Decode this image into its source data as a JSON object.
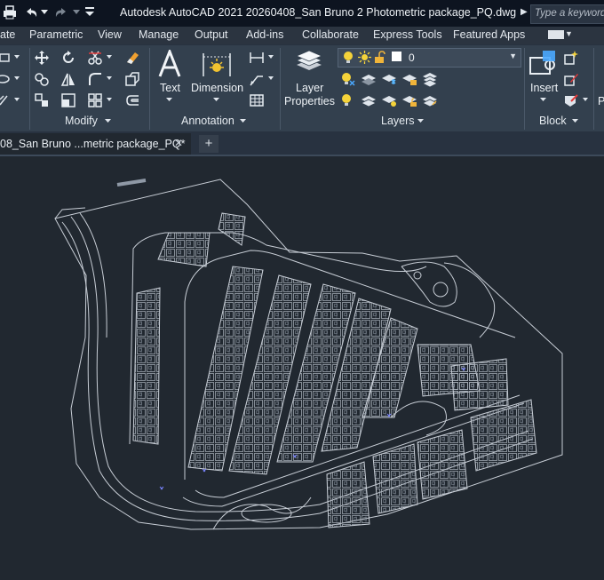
{
  "titlebar": {
    "title": "Autodesk AutoCAD 2021    20260408_San Bruno 2 Photometric package_PQ.dwg",
    "search_placeholder": "Type a keyword or"
  },
  "ribbon_tabs": [
    "ate",
    "Parametric",
    "View",
    "Manage",
    "Output",
    "Add-ins",
    "Collaborate",
    "Express Tools",
    "Featured Apps"
  ],
  "ribbon": {
    "modify_label": "Modify",
    "annotation_label": "Annotation",
    "layers_label": "Layers",
    "block_label": "Block",
    "text_label": "Text",
    "dimension_label": "Dimension",
    "layer_properties_line1": "Layer",
    "layer_properties_line2": "Properties",
    "insert_label": "Insert",
    "current_layer": "0",
    "p_label": "P"
  },
  "document_tab": {
    "label": "08_San Bruno ...metric package_PQ*",
    "close_glyph": "✕",
    "new_tab_glyph": "+"
  },
  "colors": {
    "title_bg": "#0d1420",
    "ribbon_bg": "#33404e",
    "canvas_bg": "#212830",
    "drawing_lines": "#c8ced6"
  }
}
